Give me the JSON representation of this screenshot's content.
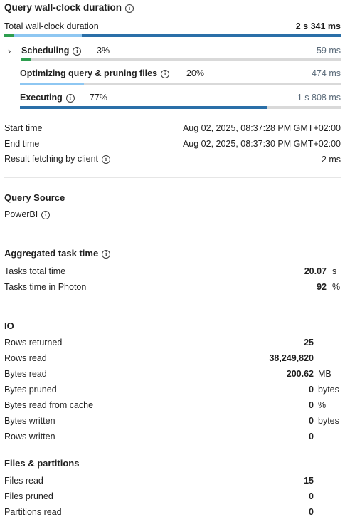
{
  "wallclock": {
    "title": "Query wall-clock duration",
    "total_label": "Total wall-clock duration",
    "total_value": "2 s 341 ms",
    "colors": {
      "scheduling": "#2e9e4f",
      "optimizing": "#8ec7f2",
      "executing": "#2a6fa8",
      "track": "#d9d9d9"
    },
    "shares": {
      "scheduling": 0.03,
      "optimizing": 0.2,
      "executing": 0.77
    },
    "phases": [
      {
        "label": "Scheduling",
        "pct": "3%",
        "value": "59 ms"
      },
      {
        "label": "Optimizing query & pruning files",
        "pct": "20%",
        "value": "474 ms"
      },
      {
        "label": "Executing",
        "pct": "77%",
        "value": "1 s 808 ms"
      }
    ]
  },
  "times": [
    {
      "label": "Start time",
      "value": "Aug 02, 2025, 08:37:28 PM GMT+02:00"
    },
    {
      "label": "End time",
      "value": "Aug 02, 2025, 08:37:30 PM GMT+02:00"
    },
    {
      "label": "Result fetching by client",
      "value": "2 ms"
    }
  ],
  "source": {
    "title": "Query Source",
    "value": "PowerBI"
  },
  "aggregated": {
    "title": "Aggregated task time",
    "rows": [
      {
        "label": "Tasks total time",
        "value": "20.07",
        "unit": "s"
      },
      {
        "label": "Tasks time in Photon",
        "value": "92",
        "unit": "%"
      }
    ]
  },
  "io": {
    "title": "IO",
    "rows": [
      {
        "label": "Rows returned",
        "value": "25",
        "unit": ""
      },
      {
        "label": "Rows read",
        "value": "38,249,820",
        "unit": ""
      },
      {
        "label": "Bytes read",
        "value": "200.62",
        "unit": "MB"
      },
      {
        "label": "Bytes pruned",
        "value": "0",
        "unit": "bytes"
      },
      {
        "label": "Bytes read from cache",
        "value": "0",
        "unit": "%"
      },
      {
        "label": "Bytes written",
        "value": "0",
        "unit": "bytes"
      },
      {
        "label": "Rows written",
        "value": "0",
        "unit": ""
      }
    ]
  },
  "files": {
    "title": "Files & partitions",
    "rows": [
      {
        "label": "Files read",
        "value": "15"
      },
      {
        "label": "Files pruned",
        "value": "0"
      },
      {
        "label": "Partitions read",
        "value": "0"
      }
    ]
  }
}
